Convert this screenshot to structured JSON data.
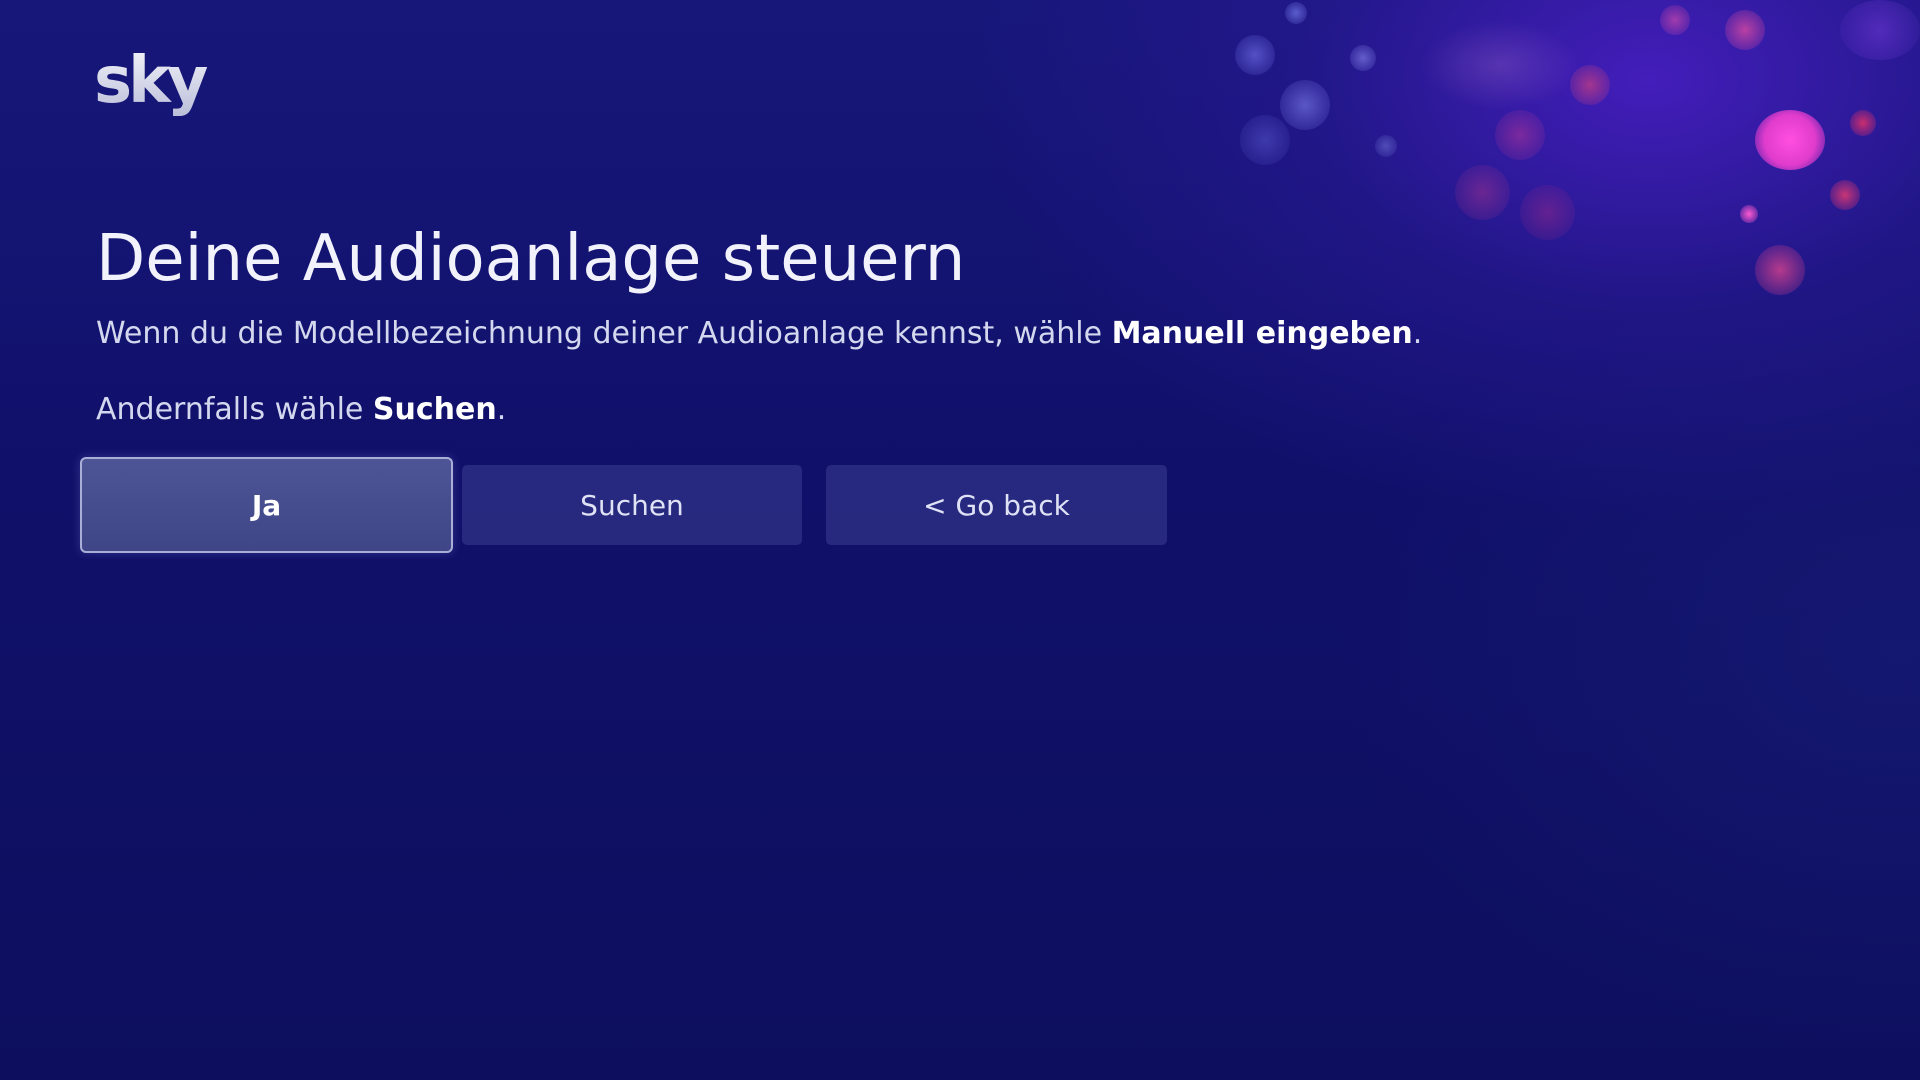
{
  "brand": {
    "logo_text": "sky"
  },
  "page": {
    "title": "Deine Audioanlage steuern",
    "line1_prefix": "Wenn du die Modellbezeichnung deiner Audioanlage kennst, wähle ",
    "line1_bold": "Manuell eingeben",
    "line1_suffix": ".",
    "line2_prefix": "Andernfalls wähle ",
    "line2_bold": "Suchen",
    "line2_suffix": "."
  },
  "buttons": {
    "ja": "Ja",
    "suchen": "Suchen",
    "go_back": "< Go back"
  },
  "colors": {
    "background": "#10106a",
    "button": "#2a2e82",
    "button_focused": "#4d5596",
    "accent_pink": "#e040c8"
  }
}
